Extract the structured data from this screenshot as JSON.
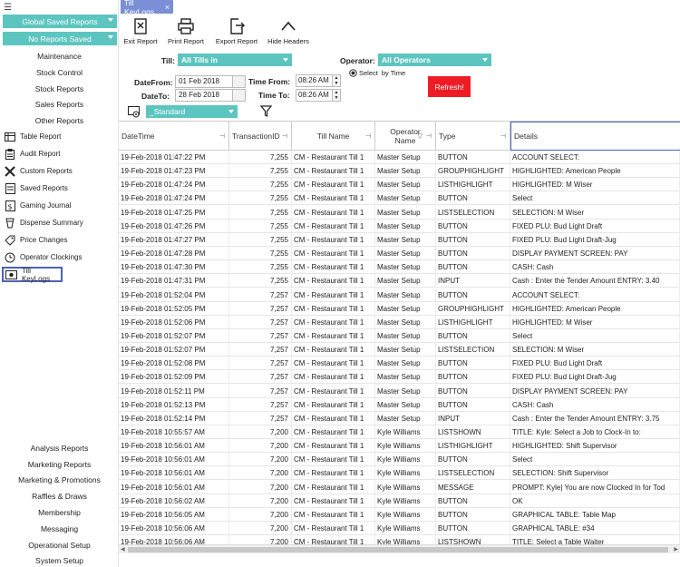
{
  "sidebar": {
    "global_dropdown": "Global Saved Reports",
    "reports_dropdown": "No Reports Saved",
    "top_links": [
      "Maintenance",
      "Stock Control",
      "Stock Reports",
      "Sales Reports",
      "Other Reports"
    ],
    "items": [
      {
        "label": "Table Report",
        "icon": "table-report-icon"
      },
      {
        "label": "Audit Report",
        "icon": "audit-report-icon"
      },
      {
        "label": "Custom Reports",
        "icon": "custom-reports-icon"
      },
      {
        "label": "Saved Reports",
        "icon": "saved-reports-icon"
      },
      {
        "label": "Gaming Journal",
        "icon": "gaming-journal-icon"
      },
      {
        "label": "Dispense Summary",
        "icon": "dispense-summary-icon"
      },
      {
        "label": "Price Changes",
        "icon": "price-tag-icon"
      },
      {
        "label": "Operator Clockings",
        "icon": "clock-icon"
      },
      {
        "label": "Till KeyLogs",
        "icon": "till-keylogs-icon",
        "active": true
      }
    ],
    "bottom_links": [
      "Analysis Reports",
      "Marketing Reports",
      "Marketing & Promotions",
      "Raffles & Draws",
      "Membership",
      "Messaging",
      "Operational Setup",
      "System Setup"
    ]
  },
  "tab": {
    "label": "Till KeyLogs"
  },
  "toolbar": {
    "exit_label": "Exit Report",
    "print_label": "Print Report",
    "export_label": "Export Report",
    "hide_label": "Hide Headers"
  },
  "filters": {
    "till_label": "Till:",
    "till_value": "All Tills in",
    "operator_label": "Operator:",
    "operator_value": "All Operators",
    "select_by_time_prefix": "Select",
    "select_by_time": "by Time",
    "date_from_label": "DateFrom:",
    "date_from": "01 Feb 2018",
    "date_to_label": "DateTo:",
    "date_to": "28 Feb 2018",
    "time_from_label": "Time From:",
    "time_from": "08:26 AM",
    "time_to_label": "Time To:",
    "time_to": "08:26 AM",
    "layout_value": "_Standard",
    "refresh_label": "Refresh!"
  },
  "grid": {
    "columns": [
      "DateTime",
      "TransactionID",
      "Till Name",
      "Operator Name",
      "Type",
      "Details"
    ],
    "rows": [
      [
        "19-Feb-2018 01:47:22 PM",
        "7,255",
        "CM - Restaurant Till 1",
        "Master Setup",
        "BUTTON",
        "ACCOUNT SELECT:"
      ],
      [
        "19-Feb-2018 01:47:23 PM",
        "7,255",
        "CM - Restaurant Till 1",
        "Master Setup",
        "GROUPHIGHLIGHT",
        "HIGHLIGHTED: American People"
      ],
      [
        "19-Feb-2018 01:47:24 PM",
        "7,255",
        "CM - Restaurant Till 1",
        "Master Setup",
        "LISTHIGHLIGHT",
        "HIGHLIGHTED: M Wiser"
      ],
      [
        "19-Feb-2018 01:47:24 PM",
        "7,255",
        "CM - Restaurant Till 1",
        "Master Setup",
        "BUTTON",
        "Select"
      ],
      [
        "19-Feb-2018 01:47:25 PM",
        "7,255",
        "CM - Restaurant Till 1",
        "Master Setup",
        "LISTSELECTION",
        "SELECTION: M Wiser"
      ],
      [
        "19-Feb-2018 01:47:26 PM",
        "7,255",
        "CM - Restaurant Till 1",
        "Master Setup",
        "BUTTON",
        "FIXED PLU:  Bud Light Draft"
      ],
      [
        "19-Feb-2018 01:47:27 PM",
        "7,255",
        "CM - Restaurant Till 1",
        "Master Setup",
        "BUTTON",
        "FIXED PLU:  Bud Light Draft-Jug"
      ],
      [
        "19-Feb-2018 01:47:28 PM",
        "7,255",
        "CM - Restaurant Till 1",
        "Master Setup",
        "BUTTON",
        "DISPLAY PAYMENT SCREEN:   PAY"
      ],
      [
        "19-Feb-2018 01:47:30 PM",
        "7,255",
        "CM - Restaurant Till 1",
        "Master Setup",
        "BUTTON",
        "CASH:   Cash"
      ],
      [
        "19-Feb-2018 01:47:31 PM",
        "7,255",
        "CM - Restaurant Till 1",
        "Master Setup",
        "INPUT",
        "Cash : Enter the Tender Amount    ENTRY: 3.40"
      ],
      [
        "19-Feb-2018 01:52:04 PM",
        "7,257",
        "CM - Restaurant Till 1",
        "Master Setup",
        "BUTTON",
        "ACCOUNT SELECT:"
      ],
      [
        "19-Feb-2018 01:52:05 PM",
        "7,257",
        "CM - Restaurant Till 1",
        "Master Setup",
        "GROUPHIGHLIGHT",
        "HIGHLIGHTED: American People"
      ],
      [
        "19-Feb-2018 01:52:06 PM",
        "7,257",
        "CM - Restaurant Till 1",
        "Master Setup",
        "LISTHIGHLIGHT",
        "HIGHLIGHTED: M Wiser"
      ],
      [
        "19-Feb-2018 01:52:07 PM",
        "7,257",
        "CM - Restaurant Till 1",
        "Master Setup",
        "BUTTON",
        "Select"
      ],
      [
        "19-Feb-2018 01:52:07 PM",
        "7,257",
        "CM - Restaurant Till 1",
        "Master Setup",
        "LISTSELECTION",
        "SELECTION: M Wiser"
      ],
      [
        "19-Feb-2018 01:52:08 PM",
        "7,257",
        "CM - Restaurant Till 1",
        "Master Setup",
        "BUTTON",
        "FIXED PLU:   Bud Light Draft"
      ],
      [
        "19-Feb-2018 01:52:09 PM",
        "7,257",
        "CM - Restaurant Till 1",
        "Master Setup",
        "BUTTON",
        "FIXED PLU:   Bud Light Draft-Jug"
      ],
      [
        "19-Feb-2018 01:52:11 PM",
        "7,257",
        "CM - Restaurant Till 1",
        "Master Setup",
        "BUTTON",
        "DISPLAY PAYMENT SCREEN:   PAY"
      ],
      [
        "19-Feb-2018 01:52:13 PM",
        "7,257",
        "CM - Restaurant Till 1",
        "Master Setup",
        "BUTTON",
        "CASH:   Cash"
      ],
      [
        "19-Feb-2018 01:52:14 PM",
        "7,257",
        "CM - Restaurant Till 1",
        "Master Setup",
        "INPUT",
        "Cash : Enter the Tender Amount    ENTRY: 3.75"
      ],
      [
        "19-Feb-2018 10:55:57 AM",
        "7,200",
        "CM - Restaurant Till 1",
        "Kyle  Williams",
        "LISTSHOWN",
        "TITLE: Kyle: Select a Job to Clock-In to:"
      ],
      [
        "19-Feb-2018 10:56:01 AM",
        "7,200",
        "CM - Restaurant Till 1",
        "Kyle  Williams",
        "LISTHIGHLIGHT",
        "HIGHLIGHTED: Shift Supervisor"
      ],
      [
        "19-Feb-2018 10:56:01 AM",
        "7,200",
        "CM - Restaurant Till 1",
        "Kyle  Williams",
        "BUTTON",
        "Select"
      ],
      [
        "19-Feb-2018 10:56:01 AM",
        "7,200",
        "CM - Restaurant Till 1",
        "Kyle  Williams",
        "LISTSELECTION",
        "SELECTION: Shift Supervisor"
      ],
      [
        "19-Feb-2018 10:56:01 AM",
        "7,200",
        "CM - Restaurant Till 1",
        "Kyle  Williams",
        "MESSAGE",
        "PROMPT: Kyle| You are now Clocked In for Tod"
      ],
      [
        "19-Feb-2018 10:56:02 AM",
        "7,200",
        "CM - Restaurant Till 1",
        "Kyle  Williams",
        "BUTTON",
        "OK"
      ],
      [
        "19-Feb-2018 10:56:05 AM",
        "7,200",
        "CM - Restaurant Till 1",
        "Kyle  Williams",
        "BUTTON",
        "GRAPHICAL TABLE:   Table Map"
      ],
      [
        "19-Feb-2018 10:56:06 AM",
        "7,200",
        "CM - Restaurant Till 1",
        "Kyle  Williams",
        "BUTTON",
        "GRAPHICAL TABLE:   #34"
      ],
      [
        "19-Feb-2018 10:56:06 AM",
        "7,200",
        "CM - Restaurant Till 1",
        "Kyle  Williams",
        "LISTSHOWN",
        "TITLE: Select a Table Waiter"
      ]
    ]
  },
  "colors": {
    "accent": "#5cc5c0",
    "tab": "#7a8fd6",
    "refresh": "#ee1c25",
    "active_border": "#4b62b8"
  }
}
